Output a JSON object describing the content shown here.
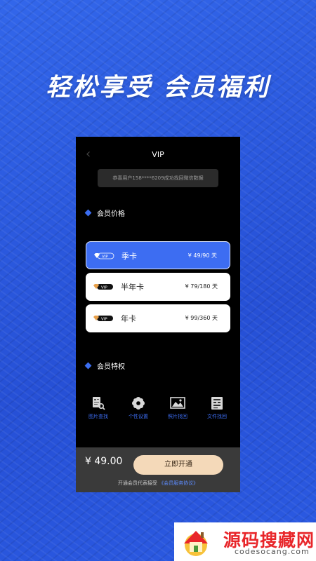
{
  "headline": "轻松享受 会员福利",
  "screen": {
    "title": "VIP",
    "notice": "恭喜用户158****6209成功找回微信数据",
    "price_section_title": "会员价格",
    "plans": [
      {
        "name": "季卡",
        "price": "¥ 49/90 天",
        "selected": true
      },
      {
        "name": "半年卡",
        "price": "¥ 79/180 天",
        "selected": false
      },
      {
        "name": "年卡",
        "price": "¥ 99/360 天",
        "selected": false
      }
    ],
    "badge_text": "VIP",
    "privilege_section_title": "会员特权",
    "privileges": [
      {
        "label": "图片查找",
        "icon": "image-search-icon"
      },
      {
        "label": "个性设置",
        "icon": "flower-settings-icon"
      },
      {
        "label": "照片找回",
        "icon": "photo-icon"
      },
      {
        "label": "文件找回",
        "icon": "document-icon"
      }
    ],
    "footer": {
      "total": "¥ 49.00",
      "pay_button": "立即开通",
      "agree_text": "开通会员代表接受",
      "agree_link": "《会员服务协议》"
    }
  },
  "watermark": {
    "text": "源码搜藏网",
    "domain": "codesocang.com"
  },
  "colors": {
    "background": "#2a5be0",
    "accent": "#3d6df2",
    "button": "#f4d9b9"
  }
}
